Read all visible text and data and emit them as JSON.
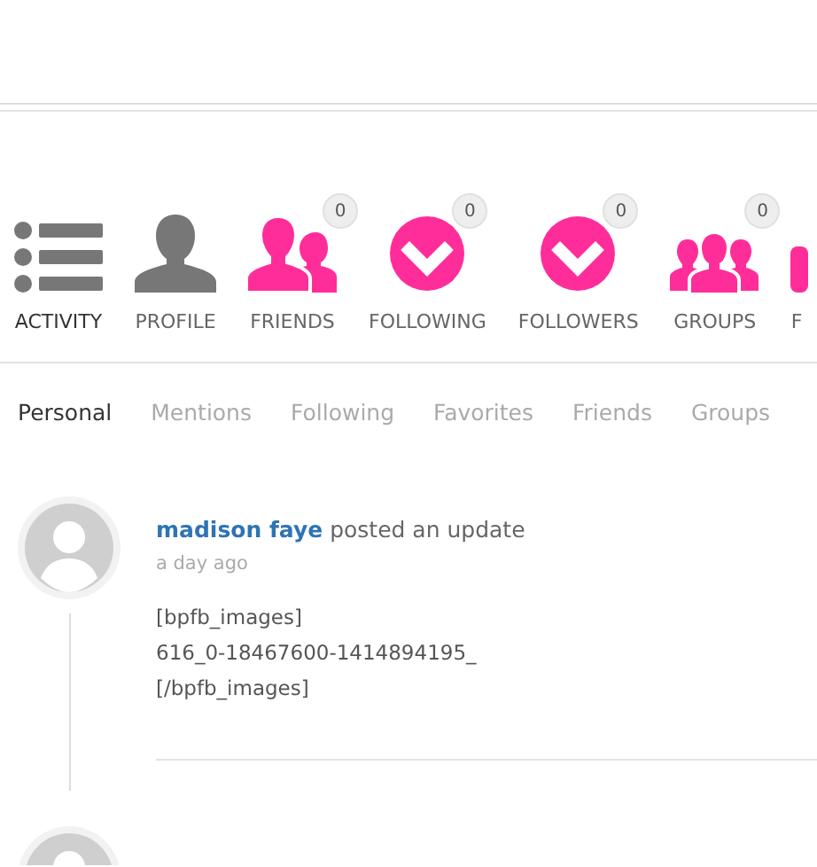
{
  "nav": [
    {
      "label": "ACTIVITY",
      "kind": "list",
      "selected": true
    },
    {
      "label": "PROFILE",
      "kind": "person",
      "selected": false
    },
    {
      "label": "FRIENDS",
      "kind": "friends",
      "selected": false,
      "count": "0"
    },
    {
      "label": "FOLLOWING",
      "kind": "check",
      "selected": false,
      "count": "0"
    },
    {
      "label": "FOLLOWERS",
      "kind": "check",
      "selected": false,
      "count": "0"
    },
    {
      "label": "GROUPS",
      "kind": "groups",
      "selected": false,
      "count": "0"
    },
    {
      "label": "F",
      "kind": "cut",
      "selected": false
    }
  ],
  "tabs": [
    {
      "label": "Personal",
      "selected": true
    },
    {
      "label": "Mentions",
      "selected": false
    },
    {
      "label": "Following",
      "selected": false
    },
    {
      "label": "Favorites",
      "selected": false
    },
    {
      "label": "Friends",
      "selected": false
    },
    {
      "label": "Groups",
      "selected": false
    }
  ],
  "activity": [
    {
      "user": "madison faye",
      "action": "posted an update",
      "time": "a day ago",
      "lines": [
        "[bpfb_images]",
        "616_0-18467600-1414894195_",
        "[/bpfb_images]"
      ]
    }
  ]
}
